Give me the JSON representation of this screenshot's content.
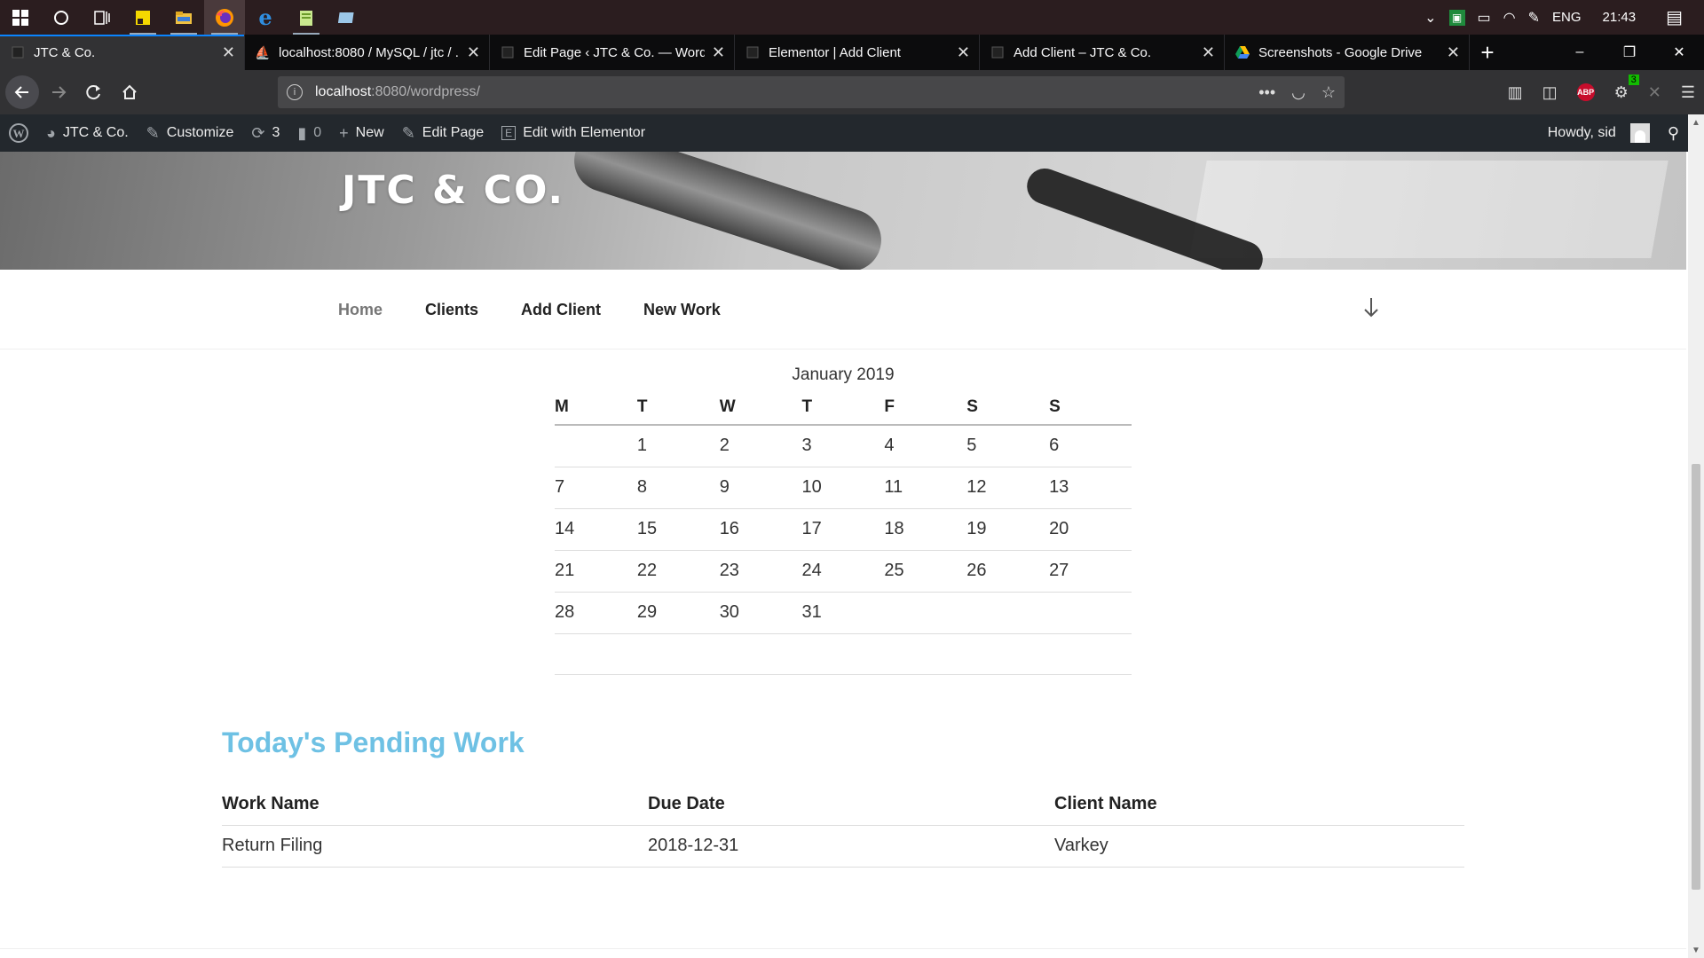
{
  "taskbar": {
    "icons": [
      "windows-start",
      "cortana-search",
      "task-view",
      "sticky-notes",
      "file-explorer",
      "firefox",
      "edge",
      "notepad-plus",
      "mail-app"
    ],
    "tray": {
      "lang": "ENG",
      "time": "21:43",
      "wifi_bars": "signal"
    }
  },
  "tabs": [
    {
      "title": "JTC & Co.",
      "favicon": "page"
    },
    {
      "title": "localhost:8080 / MySQL / jtc / ...",
      "favicon": "phpmyadmin"
    },
    {
      "title": "Edit Page ‹ JTC & Co. — WordPress",
      "favicon": "page"
    },
    {
      "title": "Elementor | Add Client",
      "favicon": "page"
    },
    {
      "title": "Add Client – JTC & Co.",
      "favicon": "page"
    },
    {
      "title": "Screenshots - Google Drive",
      "favicon": "google-drive"
    }
  ],
  "browser": {
    "url_host": "localhost",
    "url_rest": ":8080/wordpress/",
    "new_tab": "+",
    "win_controls": {
      "minimize": "–",
      "restore": "❐",
      "close": "✕"
    },
    "badge_count": "3"
  },
  "adminbar": {
    "site_name": "JTC & Co.",
    "customize": "Customize",
    "updates_count": "3",
    "comments_count": "0",
    "new_label": "New",
    "edit_page": "Edit Page",
    "edit_elementor": "Edit with Elementor",
    "howdy": "Howdy, sid"
  },
  "site": {
    "title": "JTC & CO.",
    "menu": [
      "Home",
      "Clients",
      "Add Client",
      "New Work"
    ]
  },
  "calendar": {
    "caption": "January 2019",
    "weekdays": [
      "M",
      "T",
      "W",
      "T",
      "F",
      "S",
      "S"
    ],
    "weeks": [
      [
        "",
        "1",
        "2",
        "3",
        "4",
        "5",
        "6"
      ],
      [
        "7",
        "8",
        "9",
        "10",
        "11",
        "12",
        "13"
      ],
      [
        "14",
        "15",
        "16",
        "17",
        "18",
        "19",
        "20"
      ],
      [
        "21",
        "22",
        "23",
        "24",
        "25",
        "26",
        "27"
      ],
      [
        "28",
        "29",
        "30",
        "31",
        "",
        "",
        ""
      ]
    ]
  },
  "pending": {
    "heading": "Today's Pending Work",
    "columns": [
      "Work Name",
      "Due Date",
      "Client Name"
    ],
    "rows": [
      [
        "Return Filing",
        "2018-12-31",
        "Varkey"
      ]
    ]
  },
  "colors": {
    "accent": "#6ec1e4",
    "adminbar_bg": "#23282d",
    "tab_selected_accent": "#0a84ff"
  }
}
